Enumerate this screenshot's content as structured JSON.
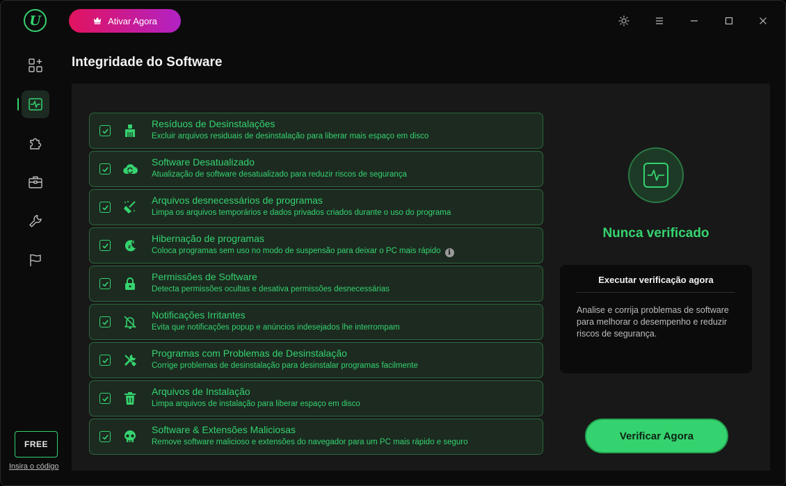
{
  "app": {
    "logo_letter": "U"
  },
  "topbar": {
    "activate_label": "Ativar Agora"
  },
  "page": {
    "title": "Integridade do Software"
  },
  "sidebar": {
    "items": [
      {
        "name": "apps-icon"
      },
      {
        "name": "software-health-icon"
      },
      {
        "name": "puzzle-icon"
      },
      {
        "name": "toolbox-icon"
      },
      {
        "name": "wrench-icon"
      },
      {
        "name": "flag-icon"
      }
    ],
    "free_label": "FREE",
    "code_link": "Insira o código"
  },
  "items": [
    {
      "icon": "broom-icon",
      "title": "Resíduos de Desinstalações",
      "desc": "Excluir arquivos residuais de desinstalação para liberar mais espaço em disco",
      "checked": true
    },
    {
      "icon": "cloud-refresh-icon",
      "title": "Software Desatualizado",
      "desc": "Atualização de software desatualizado para reduzir riscos de segurança",
      "checked": true
    },
    {
      "icon": "sweep-icon",
      "title": "Arquivos desnecessários de programas",
      "desc": "Limpa os arquivos temporários e dados privados criados durante o uso do programa",
      "checked": true
    },
    {
      "icon": "sleep-icon",
      "title": "Hibernação de programas",
      "desc": "Coloca programas sem uso no modo de suspensão para deixar o PC mais rápido",
      "checked": true,
      "info": "i"
    },
    {
      "icon": "lock-icon",
      "title": "Permissões de Software",
      "desc": "Detecta permissões ocultas e desativa permissões desnecessárias",
      "checked": true
    },
    {
      "icon": "bell-off-icon",
      "title": "Notificações Irritantes",
      "desc": "Evita que notificações popup e anúncios indesejados lhe interrompam",
      "checked": true
    },
    {
      "icon": "tools-icon",
      "title": "Programas com Problemas de Desinstalação",
      "desc": "Corrige problemas de desinstalação para desinstalar programas facilmente",
      "checked": true
    },
    {
      "icon": "trash-icon",
      "title": "Arquivos de Instalação",
      "desc": "Limpa arquivos de instalação para liberar espaço em disco",
      "checked": true
    },
    {
      "icon": "skull-icon",
      "title": "Software & Extensões Maliciosas",
      "desc": "Remove software malicioso e extensões do navegador para um PC mais rápido e seguro",
      "checked": true
    }
  ],
  "status": {
    "text": "Nunca verificado"
  },
  "info_box": {
    "title": "Executar verificação agora",
    "text": "Analise e corrija problemas de software para melhorar o desempenho e reduzir riscos de segurança."
  },
  "verify_label": "Verificar Agora",
  "colors": {
    "accent": "#35d36f",
    "row_bg": "#1c2a20",
    "activate_start": "#e1135f",
    "activate_end": "#b222c4"
  }
}
